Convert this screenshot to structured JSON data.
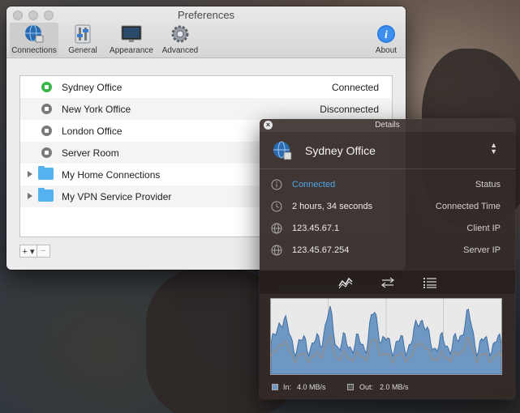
{
  "preferences": {
    "title": "Preferences",
    "toolbar": [
      {
        "label": "Connections",
        "icon": "globe-icon",
        "active": true
      },
      {
        "label": "General",
        "icon": "switches-icon",
        "active": false
      },
      {
        "label": "Appearance",
        "icon": "monitor-icon",
        "active": false
      },
      {
        "label": "Advanced",
        "icon": "gear-icon",
        "active": false
      }
    ],
    "about_label": "About",
    "connections": [
      {
        "name": "Sydney Office",
        "status": "Connected",
        "type": "vpn",
        "connected": true
      },
      {
        "name": "New York Office",
        "status": "Disconnected",
        "type": "vpn",
        "connected": false
      },
      {
        "name": "London Office",
        "status": "",
        "type": "vpn",
        "connected": false
      },
      {
        "name": "Server Room",
        "status": "",
        "type": "vpn",
        "connected": false
      },
      {
        "name": "My Home Connections",
        "status": "",
        "type": "folder"
      },
      {
        "name": "My VPN Service Provider",
        "status": "",
        "type": "folder"
      }
    ],
    "add_label": "+ ▾",
    "remove_label": "−"
  },
  "details": {
    "title": "Details",
    "connection_name": "Sydney Office",
    "rows": [
      {
        "value": "Connected",
        "label": "Status",
        "icon": "info-icon"
      },
      {
        "value": "2 hours, 34 seconds",
        "label": "Connected Time",
        "icon": "clock-icon"
      },
      {
        "value": "123.45.67.1",
        "label": "Client IP",
        "icon": "globe-icon"
      },
      {
        "value": "123.45.67.254",
        "label": "Server IP",
        "icon": "globe-icon"
      }
    ],
    "tabs": [
      "graph-icon",
      "transfer-icon",
      "list-icon"
    ],
    "legend": {
      "in_label": "In:",
      "in_value": "4.0 MB/s",
      "out_label": "Out:",
      "out_value": "2.0 MB/s"
    },
    "colors": {
      "accent": "#4ea6e6",
      "in_fill": "#6f97c3",
      "out_line": "#8f8f8f"
    }
  }
}
